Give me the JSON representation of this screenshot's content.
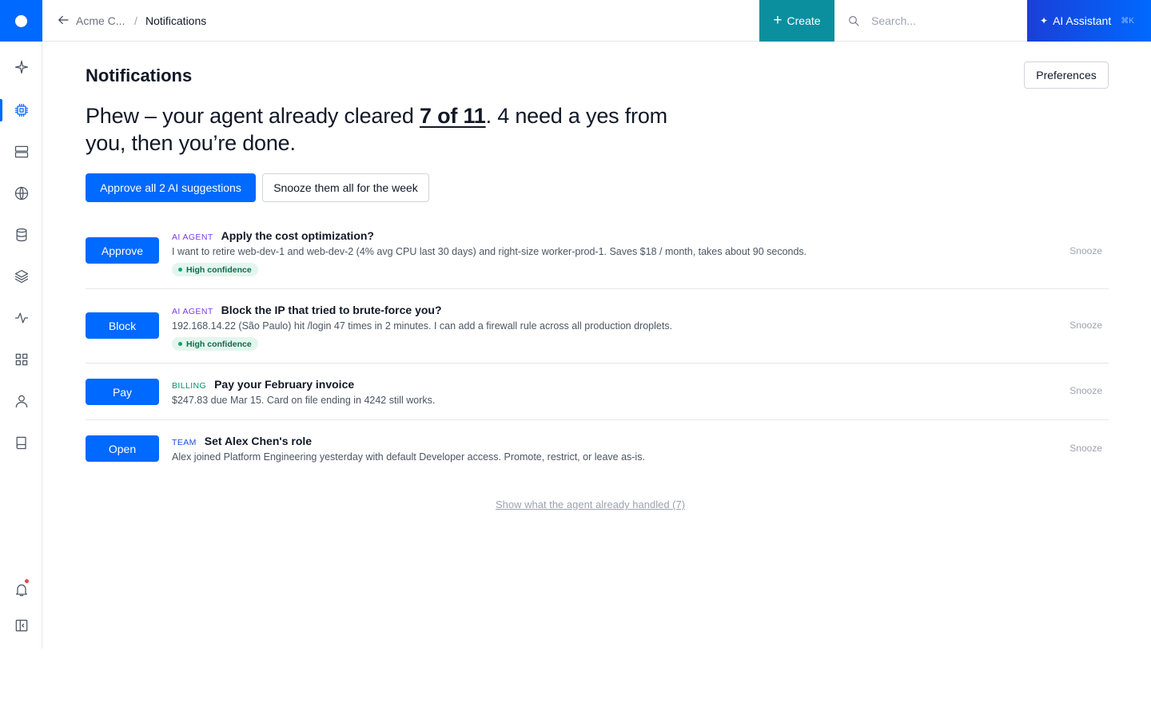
{
  "topbar": {
    "breadcrumb_org": "Acme C...",
    "breadcrumb_sep": "/",
    "breadcrumb_current": "Notifications",
    "create_label": "Create",
    "search_placeholder": "Search...",
    "ai_label": "AI Assistant",
    "ai_shortcut": "⌘K"
  },
  "sidebar": {
    "items": [
      {
        "icon": "sparkle-icon"
      },
      {
        "icon": "chip-icon",
        "active": true
      },
      {
        "icon": "server-icon"
      },
      {
        "icon": "globe-icon"
      },
      {
        "icon": "database-icon"
      },
      {
        "icon": "layers-icon"
      },
      {
        "icon": "activity-icon"
      },
      {
        "icon": "apps-grid-icon"
      },
      {
        "icon": "user-icon"
      },
      {
        "icon": "book-icon"
      }
    ],
    "bottom": [
      {
        "icon": "bell-icon",
        "has_dot": true
      },
      {
        "icon": "collapse-sidebar-icon"
      }
    ]
  },
  "main": {
    "title": "Notifications",
    "preferences_label": "Preferences",
    "headline": {
      "before": "Phew – your agent already cleared ",
      "emphasis": "7 of 11",
      "after": ". 4 need a yes from you, then you’re done."
    },
    "approve_all_label": "Approve all 2 AI suggestions",
    "snooze_all_label": "Snooze them all for the week",
    "show_handled_label": "Show what the agent already handled (7)"
  },
  "notifications": [
    {
      "action": "Approve",
      "tag": "AI AGENT",
      "title": "Apply the cost optimization?",
      "description": "I want to retire web-dev-1 and web-dev-2 (4% avg CPU last 30 days) and right-size worker-prod-1. Saves $18 / month, takes about 90 seconds.",
      "badge": "High confidence",
      "snooze": "Snooze"
    },
    {
      "action": "Block",
      "tag": "AI AGENT",
      "title": "Block the IP that tried to brute-force you?",
      "description": "192.168.14.22 (São Paulo) hit /login 47 times in 2 minutes. I can add a firewall rule across all production droplets.",
      "badge": "High confidence",
      "snooze": "Snooze"
    },
    {
      "action": "Pay",
      "tag": "BILLING",
      "title": "Pay your February invoice",
      "description": "$247.83 due Mar 15. Card on file ending in 4242 still works.",
      "snooze": "Snooze"
    },
    {
      "action": "Open",
      "tag": "TEAM",
      "title": "Set Alex Chen's role",
      "description": "Alex joined Platform Engineering yesterday with default Developer access. Promote, restrict, or leave as-is.",
      "snooze": "Snooze"
    }
  ],
  "colors": {
    "primary": "#0069ff",
    "create": "#0b8f9e",
    "ai_tag": "#7c3aed",
    "billing_tag": "#0b8f6a",
    "team_tag": "#1d4ed8",
    "badge_bg": "#e3f6ee"
  }
}
